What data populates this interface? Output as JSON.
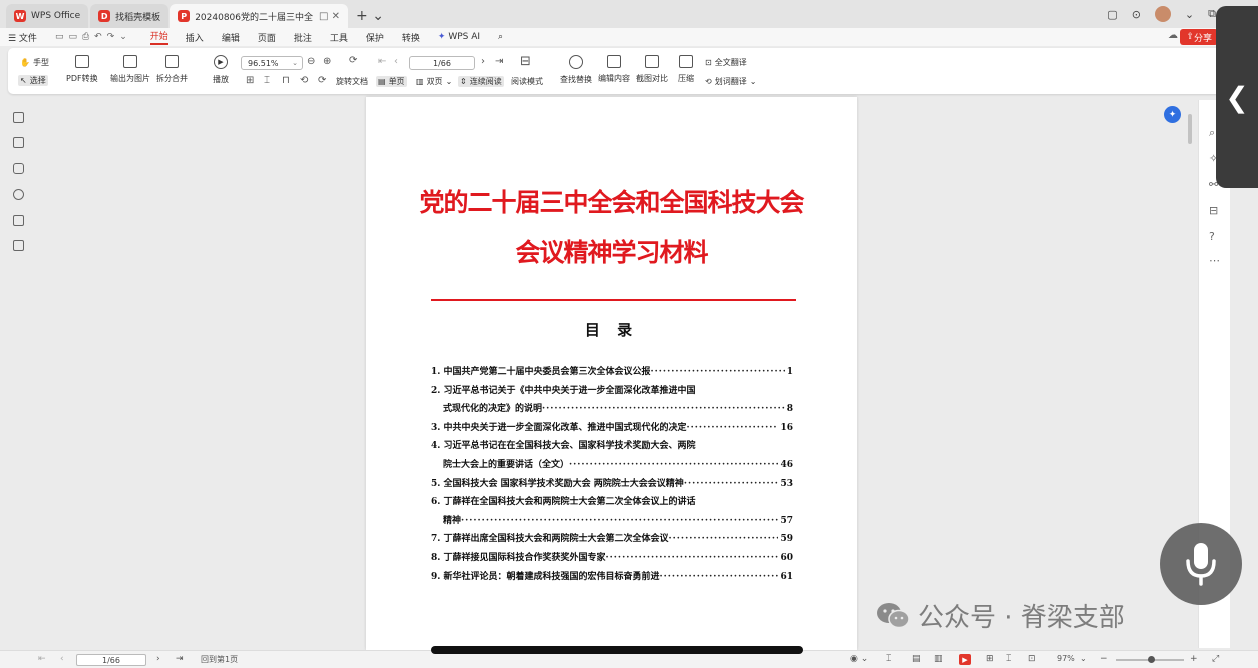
{
  "tabs": [
    {
      "label": "WPS Office",
      "badge": "W",
      "color": "#e2362b",
      "state": "inactive"
    },
    {
      "label": "找稻壳模板",
      "badge": "D",
      "color": "#e2362b",
      "state": "inactive"
    },
    {
      "label": "20240806党的二十届三中全",
      "badge": "P",
      "color": "#e2362b",
      "state": "active"
    }
  ],
  "menu": {
    "file": "☰ 文件",
    "items": [
      "开始",
      "插入",
      "编辑",
      "页面",
      "批注",
      "工具",
      "保护",
      "转换",
      "WPS AI"
    ],
    "active": "开始",
    "share": "分享"
  },
  "ribbon": {
    "hand": "手型",
    "select": "选择",
    "pdf_convert": "PDF转换",
    "export_image": "输出为图片",
    "split_merge": "拆分合并",
    "play": "播放",
    "zoom": "96.51%",
    "page": "1/66",
    "rotate": "旋转文档",
    "single": "单页",
    "double": "双页",
    "continuous": "连续阅读",
    "read_mode": "阅读模式",
    "find_replace": "查找替换",
    "edit_content": "编辑内容",
    "screenshot_compare": "截图对比",
    "compress": "压缩",
    "full_translate": "全文翻译",
    "select_translate": "划词翻译"
  },
  "document": {
    "title_line1": "党的二十届三中全会和全国科技大会",
    "title_line2": "会议精神学习材料",
    "toc_heading": "目 录",
    "toc": [
      {
        "text": "1. 中国共产党第二十届中央委员会第三次全体会议公报",
        "page": "1"
      },
      {
        "text": "2. 习近平总书记关于《中共中央关于进一步全面深化改革推进中国",
        "page": ""
      },
      {
        "text": "式现代化的决定》的说明",
        "page": "8",
        "cont": true
      },
      {
        "text": "3. 中共中央关于进一步全面深化改革、推进中国式现代化的决定",
        "page": "16"
      },
      {
        "text": "4. 习近平总书记在在全国科技大会、国家科学技术奖励大会、两院",
        "page": ""
      },
      {
        "text": "院士大会上的重要讲话（全文）",
        "page": "46",
        "cont": true
      },
      {
        "text": "5. 全国科技大会 国家科学技术奖励大会 两院院士大会会议精神",
        "page": "53"
      },
      {
        "text": "6. 丁薛祥在全国科技大会和两院院士大会第二次全体会议上的讲话",
        "page": ""
      },
      {
        "text": "精神",
        "page": "57",
        "cont": true
      },
      {
        "text": "7. 丁薛祥出席全国科技大会和两院院士大会第二次全体会议",
        "page": "59"
      },
      {
        "text": "8. 丁薛祥接见国际科技合作奖获奖外国专家",
        "page": "60"
      },
      {
        "text": "9. 新华社评论员：朝着建成科技强国的宏伟目标奋勇前进",
        "page": "61"
      }
    ]
  },
  "status": {
    "page": "1/66",
    "page_label": "回到第1页",
    "zoom": "97%"
  },
  "watermark": "公众号 · 脊梁支部",
  "colors": {
    "accent": "#e2362b",
    "title_red": "#e0191f",
    "ai_blue": "#2f6fe0"
  }
}
